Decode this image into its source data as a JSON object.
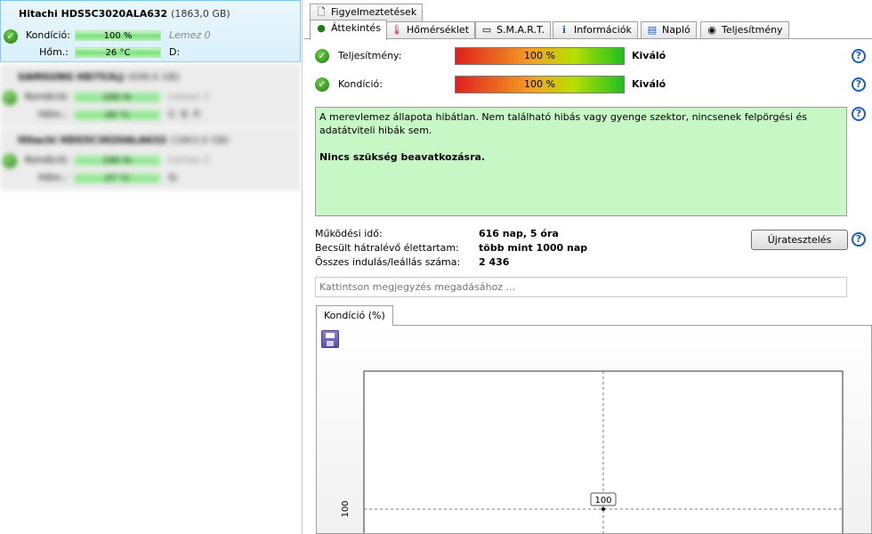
{
  "drives": [
    {
      "model": "Hitachi HDS5C3020ALA632",
      "size": "(1863,0 GB)",
      "health_label": "Kondíció:",
      "health_value": "100 %",
      "disk_label": "Lemez 0",
      "temp_label": "Hőm.:",
      "temp_value": "26 °C",
      "volume": "D:"
    },
    {
      "model": "SAMSUNG HD753LJ",
      "size": "(698,6 GB)",
      "health_label": "Kondíció:",
      "health_value": "100 %",
      "disk_label": "Lemez 1",
      "temp_label": "Hőm.:",
      "temp_value": "28 °C",
      "volume": "C: E: F:"
    },
    {
      "model": "Hitachi HDS5C3020ALA632",
      "size": "(1863,0 GB)",
      "health_label": "Kondíció:",
      "health_value": "100 %",
      "disk_label": "Lemez 2",
      "temp_label": "Hőm.:",
      "temp_value": "27 °C",
      "volume": "G:"
    }
  ],
  "tabs": {
    "warnings": "Figyelmeztetések",
    "items": [
      "Áttekintés",
      "Hőmérséklet",
      "S.M.A.R.T.",
      "Információk",
      "Napló",
      "Teljesítmény"
    ],
    "active_index": 0
  },
  "status": {
    "performance": {
      "label": "Teljesítmény:",
      "value": "100 %",
      "percent": 100,
      "rating": "Kiváló"
    },
    "health": {
      "label": "Kondíció:",
      "value": "100 %",
      "percent": 100,
      "rating": "Kiváló"
    }
  },
  "summary": {
    "text": "A merevlemez állapota hibátlan. Nem található hibás vagy gyenge szektor, nincsenek felpörgési és adatátviteli hibák sem.",
    "action": "Nincs szükség beavatkozásra."
  },
  "info": {
    "uptime_label": "Működési idő:",
    "uptime_value": "616 nap, 5 óra",
    "lifetime_label": "Becsült hátralévő élettartam:",
    "lifetime_value": "több mint 1000 nap",
    "startstop_label": "Összes indulás/leállás száma:",
    "startstop_value": "2 436"
  },
  "retest_label": "Újratesztelés",
  "note_placeholder": "Kattintson megjegyzés megadásához ...",
  "help_symbol": "?",
  "chart_tab_label": "Kondíció  (%)",
  "chart_data": {
    "type": "line",
    "series": [
      {
        "values": [
          100
        ]
      }
    ],
    "y_tick_labels": [
      "100"
    ],
    "data_labels": [
      "100"
    ],
    "grid": true
  }
}
